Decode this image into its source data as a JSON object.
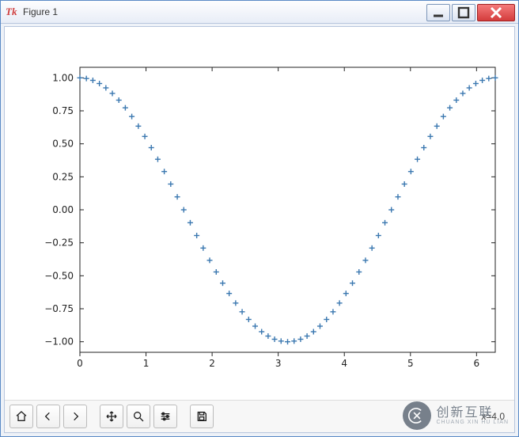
{
  "window": {
    "title": "Figure 1",
    "app_icon_glyph": "Tk"
  },
  "toolbar": {
    "status": "x=4.0"
  },
  "watermark": {
    "cn": "创新互联",
    "en": "CHUANG XIN HU LIAN"
  },
  "chart_data": {
    "type": "scatter",
    "marker": "+",
    "color": "#3b78b0",
    "xlabel": "",
    "ylabel": "",
    "title": "",
    "xlim": [
      0.0,
      6.283185307179586
    ],
    "ylim": [
      -1.08,
      1.08
    ],
    "xticks": [
      0,
      1,
      2,
      3,
      4,
      5,
      6
    ],
    "yticks": [
      -1.0,
      -0.75,
      -0.5,
      -0.25,
      0.0,
      0.25,
      0.5,
      0.75,
      1.0
    ],
    "ytick_labels": [
      "−1.00",
      "−0.75",
      "−0.50",
      "−0.25",
      "0.00",
      "0.25",
      "0.50",
      "0.75",
      "1.00"
    ],
    "x": [
      0.0,
      0.098,
      0.196,
      0.295,
      0.393,
      0.491,
      0.589,
      0.687,
      0.785,
      0.884,
      0.982,
      1.08,
      1.178,
      1.276,
      1.374,
      1.473,
      1.571,
      1.669,
      1.767,
      1.865,
      1.963,
      2.062,
      2.16,
      2.258,
      2.356,
      2.454,
      2.553,
      2.651,
      2.749,
      2.847,
      2.945,
      3.043,
      3.142,
      3.24,
      3.338,
      3.436,
      3.534,
      3.632,
      3.731,
      3.829,
      3.927,
      4.025,
      4.123,
      4.222,
      4.32,
      4.418,
      4.516,
      4.614,
      4.712,
      4.811,
      4.909,
      5.007,
      5.105,
      5.203,
      5.301,
      5.4,
      5.498,
      5.596,
      5.694,
      5.792,
      5.89,
      5.989,
      6.087,
      6.185,
      6.283
    ],
    "y": [
      1.0,
      0.995,
      0.981,
      0.957,
      0.924,
      0.882,
      0.831,
      0.773,
      0.707,
      0.634,
      0.556,
      0.471,
      0.383,
      0.29,
      0.195,
      0.098,
      0.0,
      -0.098,
      -0.195,
      -0.29,
      -0.383,
      -0.471,
      -0.556,
      -0.634,
      -0.707,
      -0.773,
      -0.831,
      -0.882,
      -0.924,
      -0.957,
      -0.981,
      -0.995,
      -1.0,
      -0.995,
      -0.981,
      -0.957,
      -0.924,
      -0.882,
      -0.831,
      -0.773,
      -0.707,
      -0.634,
      -0.556,
      -0.471,
      -0.383,
      -0.29,
      -0.195,
      -0.098,
      0.0,
      0.098,
      0.195,
      0.29,
      0.383,
      0.471,
      0.556,
      0.634,
      0.707,
      0.773,
      0.831,
      0.882,
      0.924,
      0.957,
      0.981,
      0.995,
      1.0
    ]
  }
}
